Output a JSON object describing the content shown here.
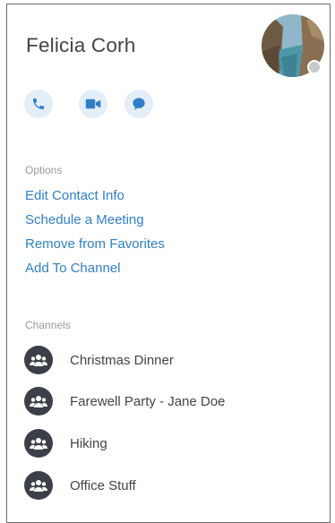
{
  "contact": {
    "name": "Felicia Corh",
    "status": "offline"
  },
  "actions": [
    {
      "label": "call",
      "icon": "phone-icon"
    },
    {
      "label": "video",
      "icon": "video-camera-icon"
    },
    {
      "label": "chat",
      "icon": "chat-bubble-icon"
    }
  ],
  "options": {
    "heading": "Options",
    "items": [
      "Edit Contact Info",
      "Schedule a Meeting",
      "Remove from Favorites",
      "Add To Channel"
    ]
  },
  "channels": {
    "heading": "Channels",
    "items": [
      "Christmas Dinner",
      "Farewell Party - Jane Doe",
      "Hiking",
      "Office Stuff"
    ]
  },
  "colors": {
    "link": "#2f7fc6",
    "action_bg": "#e4eef9",
    "action_icon": "#2f7fc6",
    "channel_icon_bg": "#3b3f48",
    "status_dot": "#c8c8c8"
  }
}
